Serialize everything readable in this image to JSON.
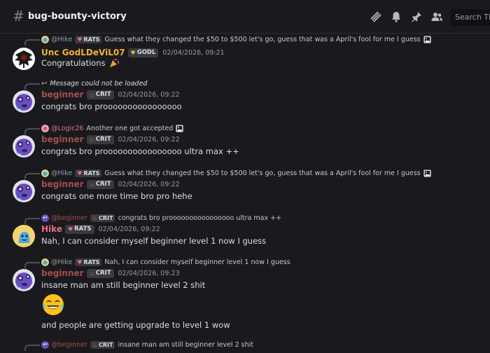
{
  "channel": {
    "name": "bug-bounty-victory"
  },
  "search": {
    "placeholder": "Search The"
  },
  "tags": {
    "rats": "RATS",
    "crit": "CRIT",
    "godl": "GODL"
  },
  "messages": [
    {
      "reply": {
        "author": "@Hike",
        "tag": "RATS",
        "text": "Guess what they changed the $50 to $500 let's go, guess that was a April's fool for me I guess"
      },
      "author": "Unc GodLDeViL07",
      "author_color": "#f0b232",
      "tag": "GODL",
      "timestamp": "02/04/2026, 09:21",
      "text": "Congratulations"
    },
    {
      "reply": {
        "text": "Message could not be loaded"
      },
      "author": "beginner",
      "author_color": "#a34f4b",
      "tag": "CRIT",
      "timestamp": "02/04/2026, 09:22",
      "text": "congrats bro proooooooooooooooo"
    },
    {
      "reply": {
        "author": "@Logic26",
        "text": "Another one got accepted"
      },
      "author": "beginner",
      "author_color": "#a34f4b",
      "tag": "CRIT",
      "timestamp": "02/04/2026, 09:22",
      "text": "congrats bro proooooooooooooooo ultra max ++"
    },
    {
      "reply": {
        "author": "@Hike",
        "tag": "RATS",
        "text": "Guess what they changed the $50 to $500 let's go, guess that was a April's fool for me I guess"
      },
      "author": "beginner",
      "author_color": "#a34f4b",
      "tag": "CRIT",
      "timestamp": "02/04/2026, 09:22",
      "text": "congrats one more time bro pro hehe"
    },
    {
      "reply": {
        "author": "@beginner",
        "tag": "CRIT",
        "text": "congrats bro proooooooooooooooo ultra max ++"
      },
      "author": "Hike",
      "author_color": "#e86e88",
      "tag": "RATS",
      "timestamp": "02/04/2026, 09:22",
      "text": "Nah, I  can consider myself beginner level 1 now  I guess"
    },
    {
      "reply": {
        "author": "@Hike",
        "tag": "RATS",
        "text": "Nah, I  can consider myself beginner level 1 now  I guess"
      },
      "author": "beginner",
      "author_color": "#a34f4b",
      "tag": "CRIT",
      "timestamp": "02/04/2026, 09:23",
      "text": "insane man am still beginner level 2 shit",
      "text2": "and people are getting upgrade to level 1 wow"
    },
    {
      "reply": {
        "author": "@beginner",
        "tag": "CRIT",
        "text": "insane man am still beginner level 2 shit"
      }
    }
  ],
  "colors": {
    "background": "#1a1a1e",
    "text": "#dbdee1",
    "muted": "#949ba4",
    "divider": "#2b2d31"
  },
  "icons": [
    "hash-icon",
    "threads-icon",
    "bell-icon",
    "pin-icon",
    "members-icon",
    "image-icon",
    "reply-arrow-icon",
    "party-popper-icon",
    "laughing-crying-emoji"
  ]
}
